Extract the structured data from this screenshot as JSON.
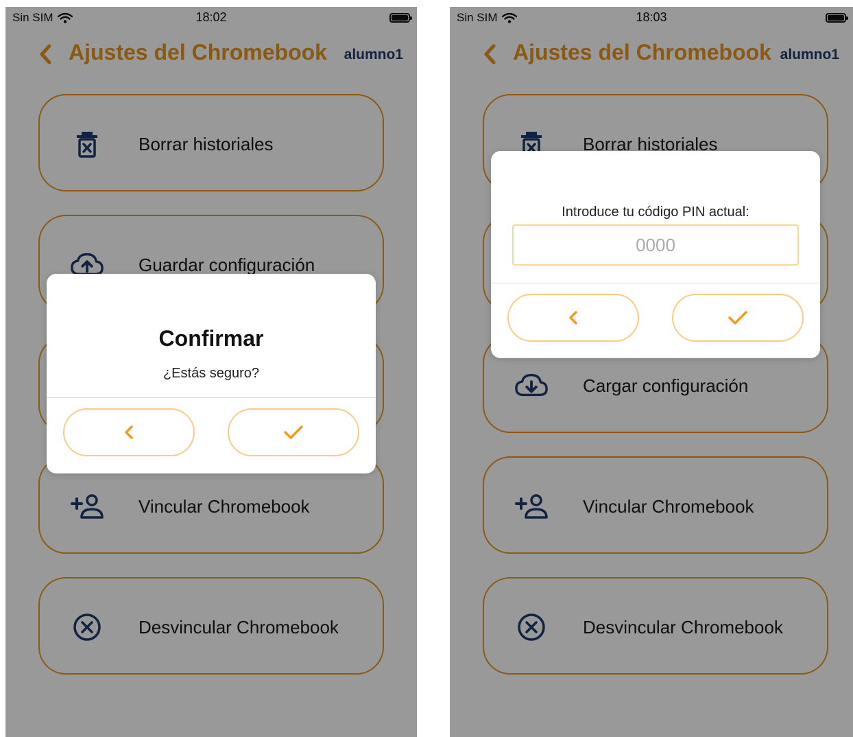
{
  "colors": {
    "accent": "#E8941F",
    "navy": "#1E3A6E",
    "button_border": "#F8CC86",
    "overlay": "rgba(0,0,0,0.40)"
  },
  "screens": [
    {
      "status": {
        "carrier": "Sin SIM",
        "time": "18:02"
      },
      "header": {
        "title": "Ajustes del Chromebook",
        "user": "alumno1"
      },
      "menu": [
        {
          "label": "Borrar historiales",
          "icon": "trash-x-icon"
        },
        {
          "label": "Guardar configuración",
          "icon": "cloud-upload-icon"
        },
        {
          "label": "",
          "icon": ""
        },
        {
          "label": "Vincular Chromebook",
          "icon": "person-add-icon"
        },
        {
          "label": "Desvincular Chromebook",
          "icon": "circle-x-icon"
        }
      ],
      "dialog": {
        "title": "Confirmar",
        "message": "¿Estás seguro?",
        "cancel_icon": "chevron-left-icon",
        "confirm_icon": "check-icon"
      }
    },
    {
      "status": {
        "carrier": "Sin SIM",
        "time": "18:03"
      },
      "header": {
        "title": "Ajustes del Chromebook",
        "user": "alumno1"
      },
      "menu": [
        {
          "label": "Borrar historiales",
          "icon": "trash-x-icon"
        },
        {
          "label": "",
          "icon": ""
        },
        {
          "label": "Cargar configuración",
          "icon": "cloud-download-icon"
        },
        {
          "label": "Vincular Chromebook",
          "icon": "person-add-icon"
        },
        {
          "label": "Desvincular Chromebook",
          "icon": "circle-x-icon"
        }
      ],
      "dialog": {
        "prompt": "Introduce tu código PIN actual:",
        "placeholder": "0000",
        "cancel_icon": "chevron-left-icon",
        "confirm_icon": "check-icon"
      }
    }
  ]
}
